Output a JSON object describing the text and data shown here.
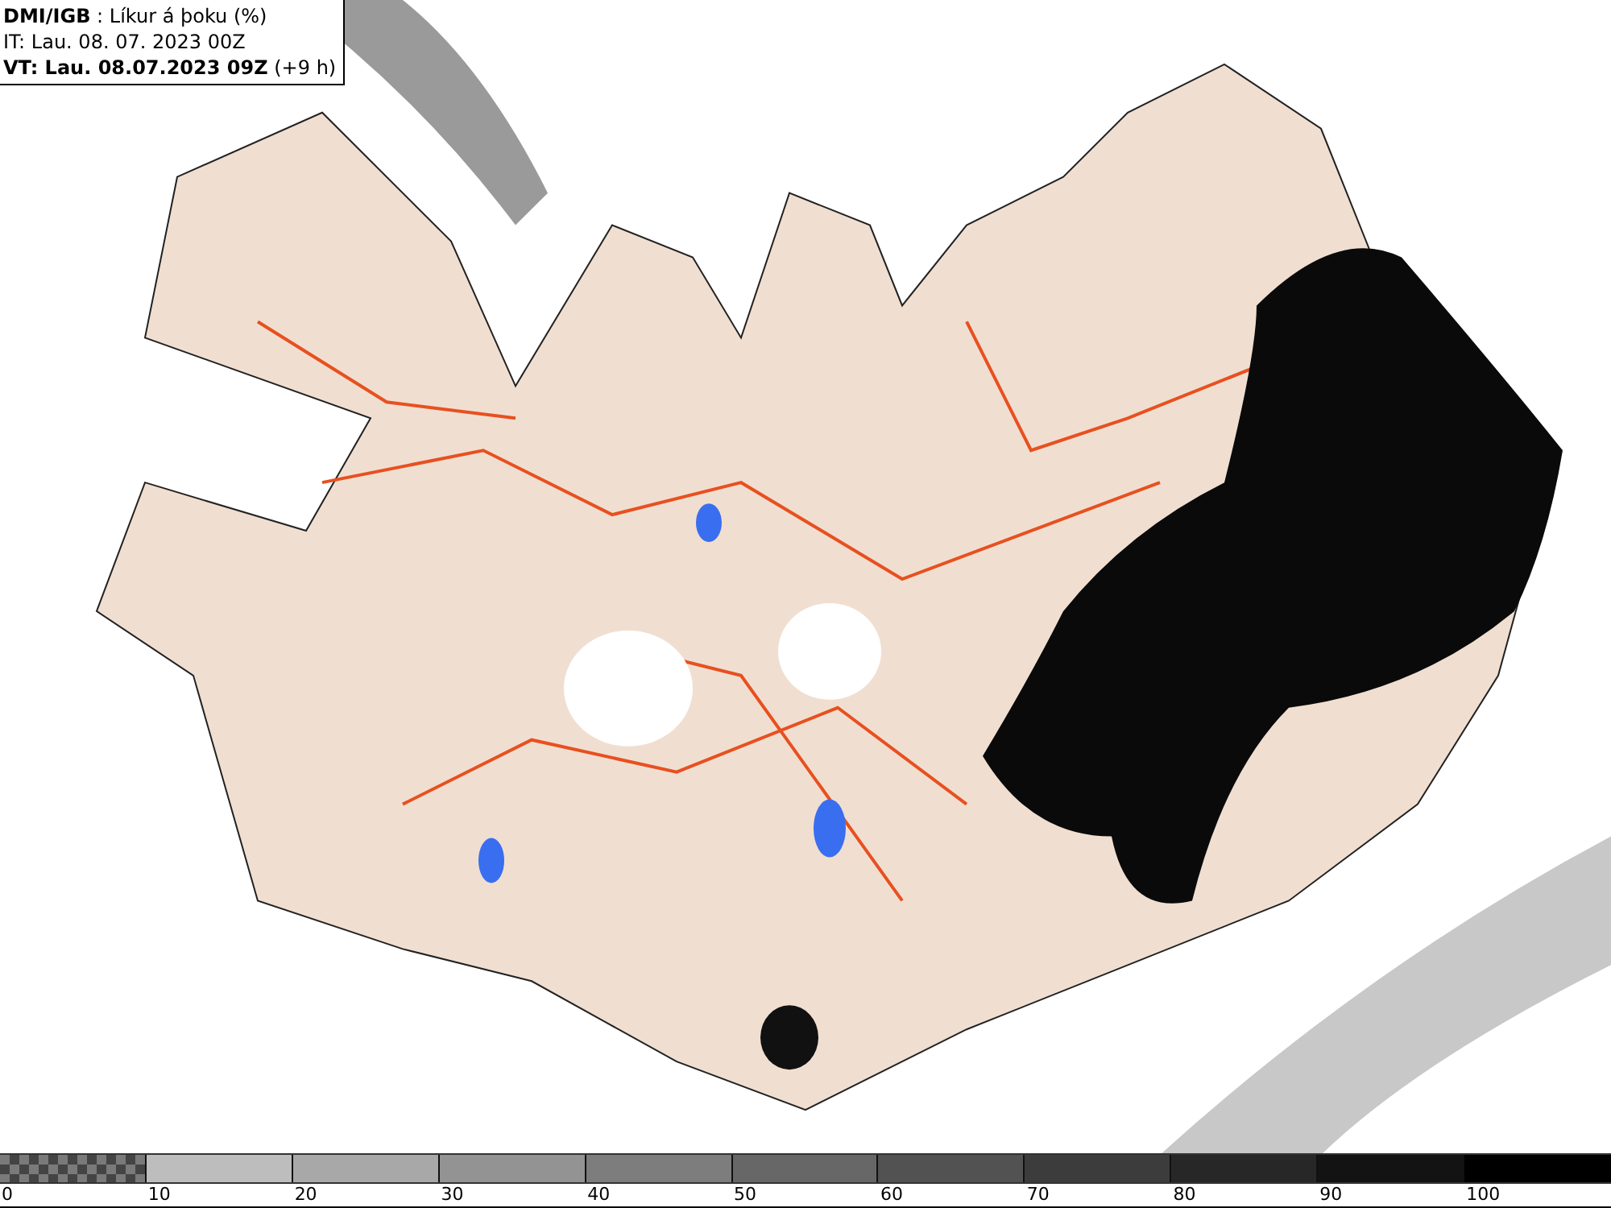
{
  "header": {
    "lines": [
      "**DMI/IGB** : Líkur á þoku (%)",
      "IT: Lau. 08. 07. 2023 00Z",
      "**VT: Lau. 08.07.2023 09Z** (+9 h)"
    ]
  },
  "legend": {
    "swatches": [
      {
        "kind": "checker",
        "color": "#7a7a7a"
      },
      {
        "kind": "solid",
        "color": "#bdbdbd"
      },
      {
        "kind": "solid",
        "color": "#a8a8a8"
      },
      {
        "kind": "solid",
        "color": "#939393"
      },
      {
        "kind": "solid",
        "color": "#7d7d7d"
      },
      {
        "kind": "solid",
        "color": "#676767"
      },
      {
        "kind": "solid",
        "color": "#525252"
      },
      {
        "kind": "solid",
        "color": "#3c3c3c"
      },
      {
        "kind": "solid",
        "color": "#272727"
      },
      {
        "kind": "solid",
        "color": "#131313"
      },
      {
        "kind": "solid",
        "color": "#000000"
      }
    ],
    "labels": [
      "0",
      "10",
      "20",
      "30",
      "40",
      "50",
      "60",
      "70",
      "80",
      "90",
      "100"
    ]
  }
}
